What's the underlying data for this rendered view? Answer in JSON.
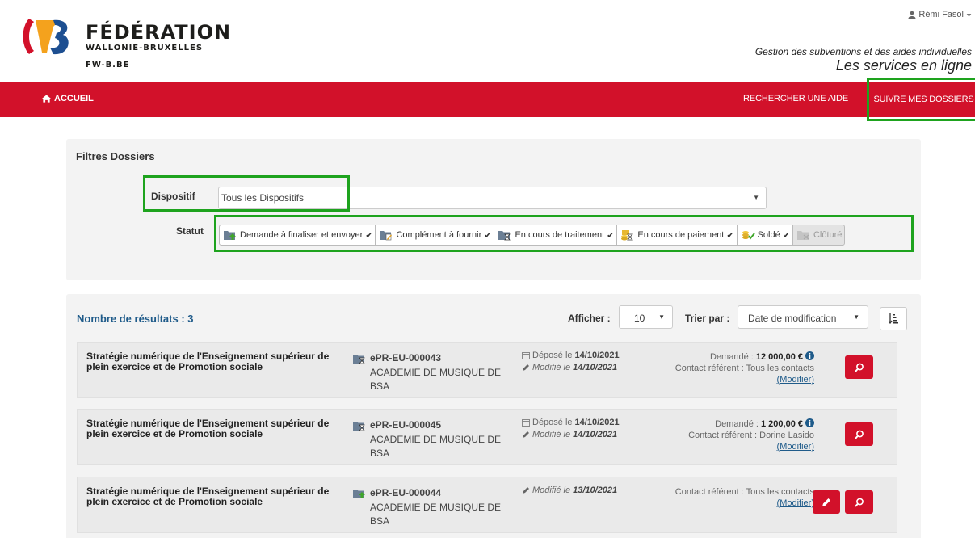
{
  "header": {
    "logo_line1": "FÉDÉRATION",
    "logo_line2": "WALLONIE-BRUXELLES",
    "logo_line3": "FW-B.BE",
    "user_name": "Rémi Fasol",
    "tagline": "Gestion des subventions et des aides individuelles",
    "services": "Les services en ligne",
    "brand_red": "#d2112a",
    "brand_blue": "#1f5b8a"
  },
  "nav": {
    "home": "ACCUEIL",
    "search": "RECHERCHER UNE AIDE",
    "follow": "SUIVRE MES DOSSIERS"
  },
  "filters": {
    "title": "Filtres Dossiers",
    "dispositif_label": "Dispositif",
    "dispositif_value": "Tous les Dispositifs",
    "statut_label": "Statut",
    "statuses": [
      {
        "label": "Demande à finaliser et envoyer",
        "icon": "folder-upload-icon",
        "checked": true
      },
      {
        "label": "Complément à fournir",
        "icon": "folder-edit-icon",
        "checked": true
      },
      {
        "label": "En cours de traitement",
        "icon": "folder-hourglass-icon",
        "checked": true
      },
      {
        "label": "En cours de paiement",
        "icon": "folder-coins-icon",
        "checked": true
      },
      {
        "label": "Soldé",
        "icon": "coins-check-icon",
        "checked": true
      },
      {
        "label": "Clôturé",
        "icon": "folder-closed-icon",
        "checked": false
      }
    ],
    "check_mark": "✔"
  },
  "results": {
    "count_label": "Nombre de résultats : 3",
    "afficher_label": "Afficher :",
    "afficher_value": "10",
    "trier_label": "Trier par :",
    "trier_value": "Date de modification",
    "rows": [
      {
        "title": "Stratégie numérique de l'Enseignement supérieur de plein exercice et de Promotion sociale",
        "ref": "ePR-EU-000043",
        "org": "ACADEMIE DE MUSIQUE DE BSA",
        "status_icon": "folder-hourglass-icon",
        "depose_prefix": "Déposé le",
        "depose_date": "14/10/2021",
        "modifie_prefix": "Modifié le",
        "modifie_date": "14/10/2021",
        "demande_prefix": "Demandé :",
        "demande_amount": "12 000,00 €",
        "contact_prefix": "Contact référent :",
        "contact": "Tous les contacts",
        "modify_link": "(Modifier)"
      },
      {
        "title": "Stratégie numérique de l'Enseignement supérieur de plein exercice et de Promotion sociale",
        "ref": "ePR-EU-000045",
        "org": "ACADEMIE DE MUSIQUE DE BSA",
        "status_icon": "folder-hourglass-icon",
        "depose_prefix": "Déposé le",
        "depose_date": "14/10/2021",
        "modifie_prefix": "Modifié le",
        "modifie_date": "14/10/2021",
        "demande_prefix": "Demandé :",
        "demande_amount": "1 200,00 €",
        "contact_prefix": "Contact référent :",
        "contact": "Dorine Lasido",
        "modify_link": "(Modifier)"
      },
      {
        "title": "Stratégie numérique de l'Enseignement supérieur de plein exercice et de Promotion sociale",
        "ref": "ePR-EU-000044",
        "org": "ACADEMIE DE MUSIQUE DE BSA",
        "status_icon": "folder-upload-icon",
        "modifie_prefix": "Modifié le",
        "modifie_date": "13/10/2021",
        "contact_prefix": "Contact référent :",
        "contact": "Tous les contacts",
        "modify_link": "(Modifier)"
      }
    ]
  }
}
